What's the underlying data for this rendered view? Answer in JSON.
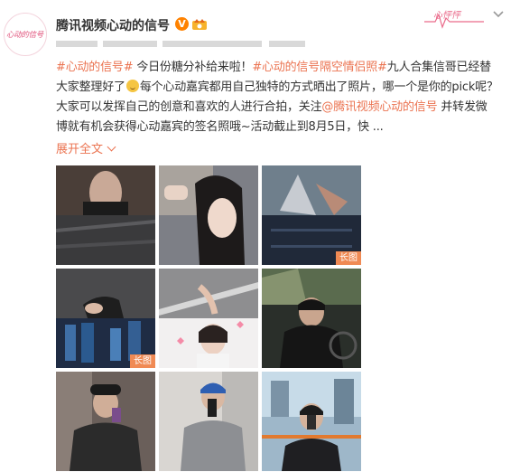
{
  "account": {
    "name": "腾讯视频心动的信号",
    "avatar_text": "心动的信号",
    "verified_icon": "verified-v-icon",
    "member_icon": "vip-crown-icon"
  },
  "header": {
    "follow_deco_text": "心怦怦",
    "menu_icon": "chevron-down-icon"
  },
  "post": {
    "segments": [
      {
        "type": "tag",
        "text": "#心动的信号#"
      },
      {
        "type": "text",
        "text": " 今日份糖分补给来啦！"
      },
      {
        "type": "tag",
        "text": "#心动的信号隔空情侣照#"
      },
      {
        "type": "text",
        "text": "九人合集信哥已经替大家整理好了"
      },
      {
        "type": "emoji",
        "text": ""
      },
      {
        "type": "text",
        "text": "每个心动嘉宾都用自己独特的方式晒出了照片，哪一个是你的pick呢？大家可以发挥自己的创意和喜欢的人进行合拍，关注"
      },
      {
        "type": "mention",
        "text": "@腾讯视频心动的信号"
      },
      {
        "type": "text",
        "text": " 并转发微博就有机会获得心动嘉宾的签名照哦~活动截止到8月5日，快 ..."
      }
    ],
    "expand_label": "展开全文"
  },
  "images": [
    {
      "badge": ""
    },
    {
      "badge": ""
    },
    {
      "badge": "长图"
    },
    {
      "badge": ""
    },
    {
      "badge": "长图"
    },
    {
      "badge": ""
    },
    {
      "badge": ""
    },
    {
      "badge": ""
    },
    {
      "badge": ""
    }
  ],
  "colors": {
    "link": "#eb7350",
    "verified": "#ff8200",
    "badge": "#f08a54"
  }
}
